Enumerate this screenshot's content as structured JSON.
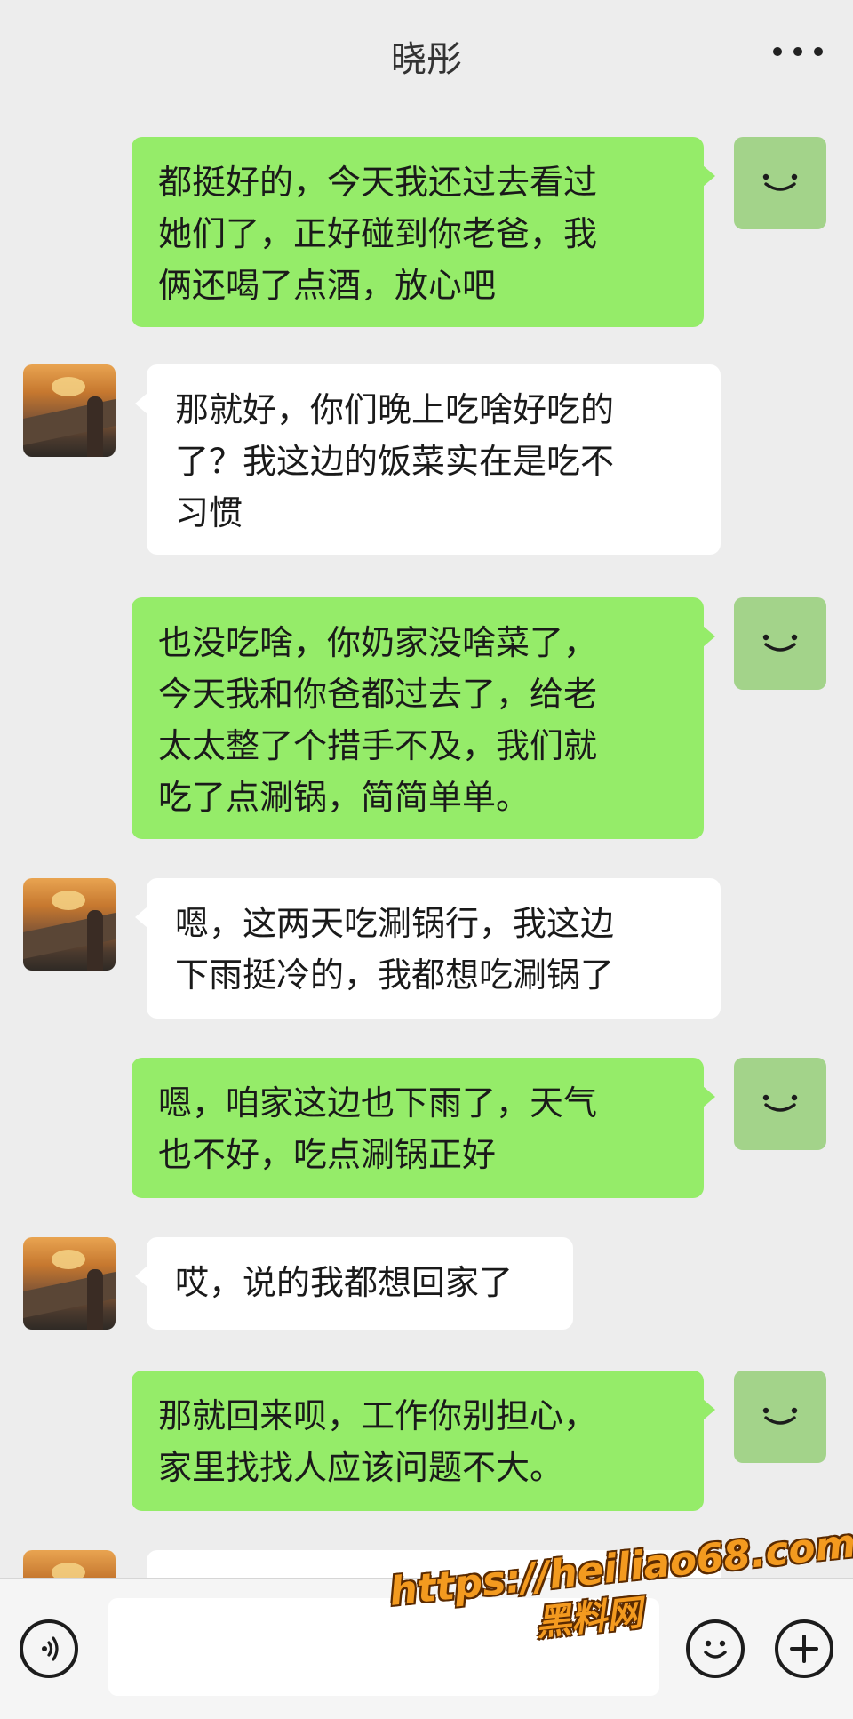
{
  "header": {
    "title": "晓彤"
  },
  "messages": [
    {
      "from": "me",
      "text": "都挺好的，今天我还过去看过\n她们了，正好碰到你老爸，我\n俩还喝了点酒，放心吧"
    },
    {
      "from": "them",
      "text": "那就好，你们晚上吃啥好吃的\n了？我这边的饭菜实在是吃不\n习惯"
    },
    {
      "from": "me",
      "text": "也没吃啥，你奶家没啥菜了，\n今天我和你爸都过去了，给老\n太太整了个措手不及，我们就\n吃了点涮锅，简简单单。"
    },
    {
      "from": "them",
      "text": "嗯，这两天吃涮锅行，我这边\n下雨挺冷的，我都想吃涮锅了"
    },
    {
      "from": "me",
      "text": "嗯，咱家这边也下雨了，天气\n也不好，吃点涮锅正好"
    },
    {
      "from": "them",
      "text": "哎，说的我都想回家了"
    },
    {
      "from": "me",
      "text": "那就回来呗，工作你别担心，\n家里找找人应该问题不大。"
    }
  ],
  "watermark": {
    "line1": "https://heiliao68.com",
    "line2": "黑料网"
  },
  "icons": {
    "voice": "voice-icon",
    "emoji": "emoji-icon",
    "add": "plus-icon",
    "more": "more-dots-icon"
  },
  "colors": {
    "my_bubble": "#95ec69",
    "their_bubble": "#ffffff",
    "background": "#ededed"
  }
}
